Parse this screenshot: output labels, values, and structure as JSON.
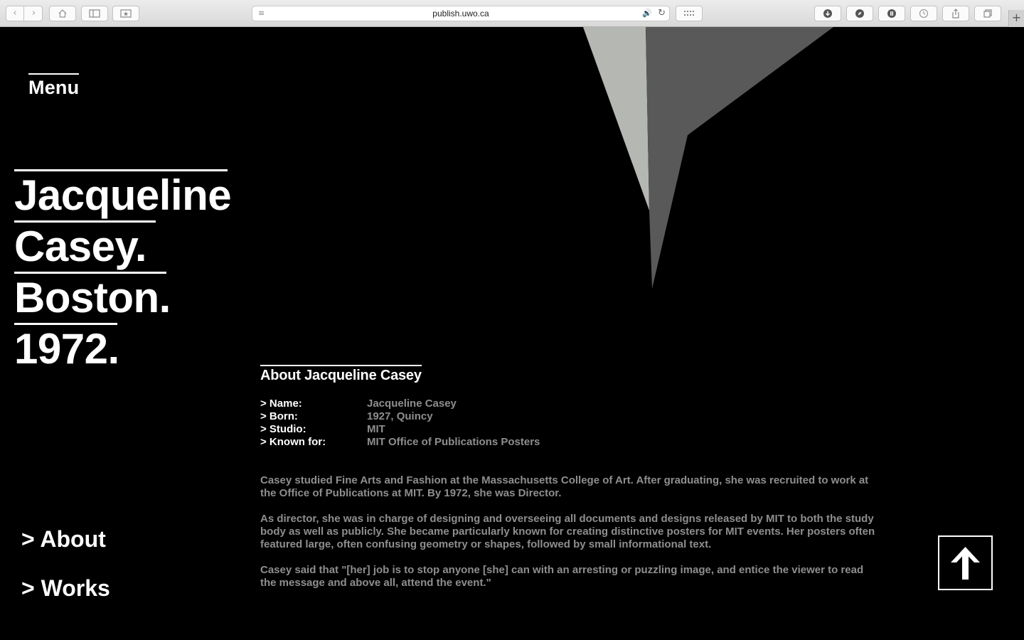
{
  "browser": {
    "url": "publish.uwo.ca",
    "back_icon": "‹",
    "forward_icon": "›",
    "new_tab_icon": "+"
  },
  "menu": {
    "label": "Menu"
  },
  "title": {
    "lines": [
      "Jacqueline",
      "Casey.",
      "Boston.",
      "1972."
    ]
  },
  "about": {
    "heading": "About Jacqueline Casey",
    "facts": [
      {
        "label": "> Name:",
        "value": "Jacqueline Casey"
      },
      {
        "label": "> Born:",
        "value": "1927, Quincy"
      },
      {
        "label": "> Studio:",
        "value": "MIT"
      },
      {
        "label": "> Known for:",
        "value": "MIT Office of Publications Posters"
      }
    ],
    "paragraphs": [
      "Casey studied Fine Arts and Fashion at the Massachusetts College of Art. After graduating, she was recruited to work at the Office of Publications at MIT. By 1972, she was Director.",
      "As director, she was in charge of designing and overseeing all documents and designs released by MIT to both the study body as well as publicly. She became particularly known for creating distinctive posters for MIT events. Her posters often featured large, often confusing geometry or shapes, followed by small informational text.",
      "Casey said that \"[her] job is to stop anyone [she] can with an arresting or puzzling image, and entice the viewer to read the message and above all, attend the event.\""
    ]
  },
  "nav": {
    "about": "> About",
    "works": "> Works"
  },
  "colors": {
    "background": "#000000",
    "text": "#ffffff",
    "muted": "#8e8e8e",
    "shape_light": "#b5b7b3",
    "shape_dark": "#595959"
  }
}
